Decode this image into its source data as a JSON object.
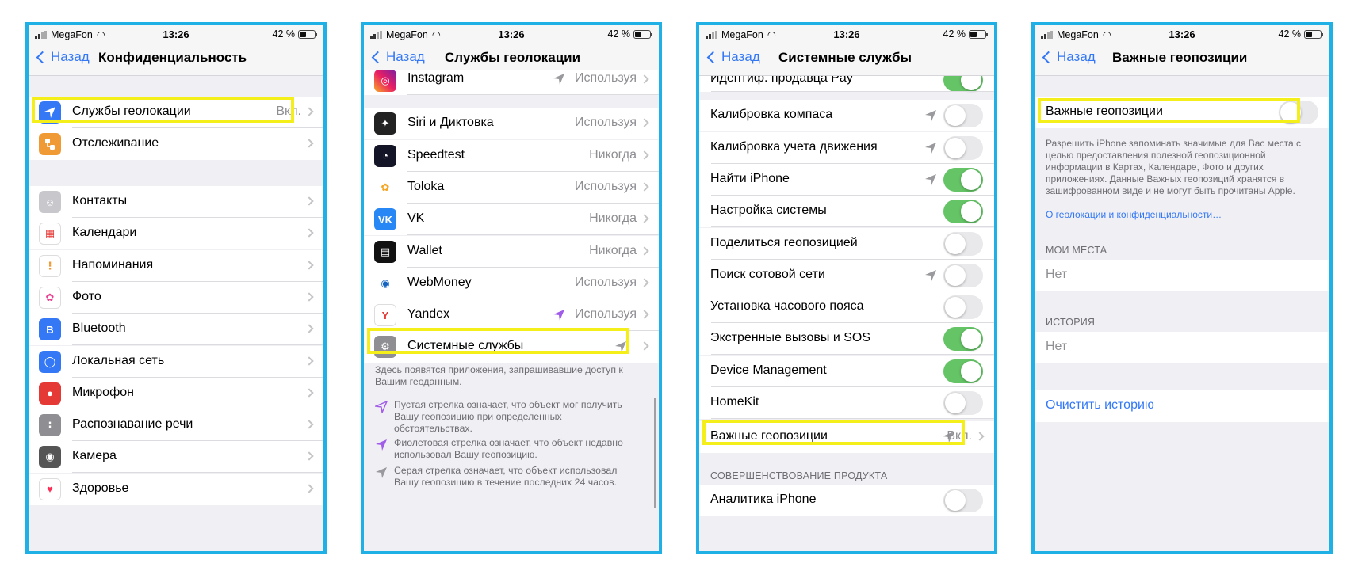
{
  "status": {
    "carrier": "MegaFon",
    "time": "13:26",
    "battery": "42 %"
  },
  "screens": [
    {
      "back": "Назад",
      "title": "Конфиденциальность",
      "top": [
        {
          "label": "Службы геолокации",
          "value": "Вкл.",
          "icon": "location-arrow-icon",
          "color": "#3478f6"
        },
        {
          "label": "Отслеживание",
          "icon": "tracking-icon",
          "color": "#f09a36"
        }
      ],
      "items": [
        {
          "label": "Контакты",
          "icon": "contacts-icon"
        },
        {
          "label": "Календари",
          "icon": "calendar-icon"
        },
        {
          "label": "Напоминания",
          "icon": "reminders-icon"
        },
        {
          "label": "Фото",
          "icon": "photos-icon"
        },
        {
          "label": "Bluetooth",
          "icon": "bluetooth-icon"
        },
        {
          "label": "Локальная сеть",
          "icon": "globe-icon"
        },
        {
          "label": "Микрофон",
          "icon": "microphone-icon"
        },
        {
          "label": "Распознавание речи",
          "icon": "speech-icon"
        },
        {
          "label": "Камера",
          "icon": "camera-icon"
        },
        {
          "label": "Здоровье",
          "icon": "health-icon"
        }
      ]
    },
    {
      "back": "Назад",
      "title": "Службы геолокации",
      "apps": [
        {
          "label": "Instagram",
          "value": "Используя",
          "arrow": "gray",
          "icon": "instagram-icon"
        },
        {
          "label": "Siri и Диктовка",
          "value": "Используя",
          "arrow": "",
          "icon": "siri-icon"
        },
        {
          "label": "Speedtest",
          "value": "Никогда",
          "arrow": "",
          "icon": "speedtest-icon"
        },
        {
          "label": "Toloka",
          "value": "Используя",
          "arrow": "",
          "icon": "toloka-icon"
        },
        {
          "label": "VK",
          "value": "Никогда",
          "arrow": "",
          "icon": "vk-icon"
        },
        {
          "label": "Wallet",
          "value": "Никогда",
          "arrow": "",
          "icon": "wallet-icon"
        },
        {
          "label": "WebMoney",
          "value": "Используя",
          "arrow": "",
          "icon": "webmoney-icon"
        },
        {
          "label": "Yandex",
          "value": "Используя",
          "arrow": "purple",
          "icon": "yandex-icon"
        },
        {
          "label": "Системные службы",
          "value": "",
          "arrow": "gray",
          "icon": "gear-icon"
        }
      ],
      "footer": "Здесь появятся приложения, запрашивавшие доступ к Вашим геоданным.",
      "legend": [
        {
          "text": "Пустая стрелка означает, что объект мог получить Вашу геопозицию при определенных обстоятельствах.",
          "icon": "hollow-arrow-icon"
        },
        {
          "text": "Фиолетовая стрелка означает, что объект недавно использовал Вашу геопозицию.",
          "icon": "purple-arrow-icon"
        },
        {
          "text": "Серая стрелка означает, что объект использовал Вашу геопозицию в течение последних 24 часов.",
          "icon": "gray-arrow-icon"
        }
      ]
    },
    {
      "back": "Назад",
      "title": "Системные службы",
      "rows": [
        {
          "label": "Идентиф. продавца Pay",
          "on": true,
          "arrow": false
        },
        {
          "label": "Калибровка компаса",
          "on": false,
          "arrow": true
        },
        {
          "label": "Калибровка учета движения",
          "on": false,
          "arrow": true
        },
        {
          "label": "Найти iPhone",
          "on": true,
          "arrow": true
        },
        {
          "label": "Настройка системы",
          "on": true,
          "arrow": false
        },
        {
          "label": "Поделиться геопозицией",
          "on": false,
          "arrow": false
        },
        {
          "label": "Поиск сотовой сети",
          "on": false,
          "arrow": true
        },
        {
          "label": "Установка часового пояса",
          "on": false,
          "arrow": false
        },
        {
          "label": "Экстренные вызовы и SOS",
          "on": true,
          "arrow": false
        },
        {
          "label": "Device Management",
          "on": true,
          "arrow": false
        },
        {
          "label": "HomeKit",
          "on": false,
          "arrow": false
        }
      ],
      "important": {
        "label": "Важные геопозиции",
        "value": "Вкл."
      },
      "section": "СОВЕРШЕНСТВОВАНИЕ ПРОДУКТА",
      "analytics": {
        "label": "Аналитика iPhone",
        "on": false
      }
    },
    {
      "back": "Назад",
      "title": "Важные геопозиции",
      "toggle": {
        "label": "Важные геопозиции",
        "on": false
      },
      "description": "Разрешить iPhone запоминать значимые для Вас места с целью предоставления полезной геопозиционной информации в Картах, Календаре, Фото и других приложениях. Данные Важных геопозиций хранятся в зашифрованном виде и не могут быть прочитаны Apple.",
      "link": "О геолокации и конфиденциальности…",
      "my_places": {
        "header": "МОИ МЕСТА",
        "value": "Нет"
      },
      "history": {
        "header": "ИСТОРИЯ",
        "value": "Нет"
      },
      "clear": "Очистить историю"
    }
  ],
  "colors": {
    "frame": "#1fb0e6",
    "highlight": "#f4ef1a",
    "ios_blue": "#3478f6",
    "toggle_on": "#65c466",
    "purple": "#a05ce8"
  }
}
